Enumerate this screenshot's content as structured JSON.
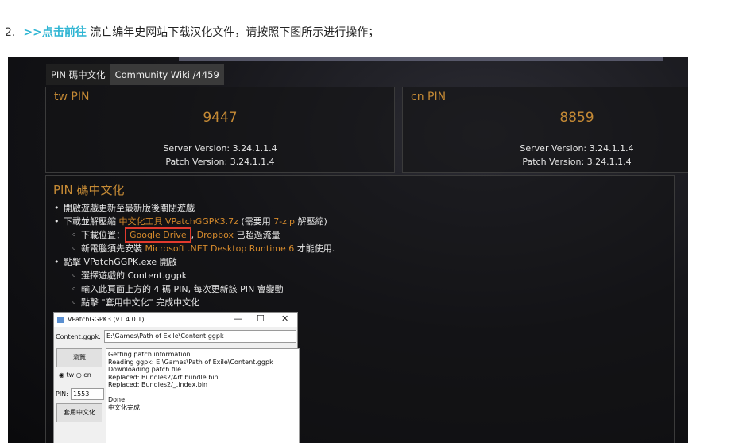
{
  "step": {
    "number": "2.",
    "link_label": ">>点击前往",
    "text": " 流亡编年史网站下载汉化文件，请按照下图所示进行操作；"
  },
  "app": {
    "tabs": [
      "PIN 碼中文化",
      "Community Wiki /4459"
    ],
    "tw": {
      "title": "tw PIN",
      "pin": "9447",
      "server_version": "Server Version: 3.24.1.1.4",
      "patch_version": "Patch Version: 3.24.1.1.4"
    },
    "cn": {
      "title": "cn PIN",
      "pin": "8859",
      "server_version": "Server Version: 3.24.1.1.4",
      "patch_version": "Patch Version: 3.24.1.1.4"
    },
    "section_title": "PIN 碼中文化",
    "items": {
      "i1": "開啟遊戲更新至最新版後關閉遊戲",
      "i2_a": "下載並解壓縮 ",
      "i2_b": "中文化工具 VPatchGGPK3.7z",
      "i2_c": " (需要用 ",
      "i2_d": "7-zip",
      "i2_e": " 解壓縮)",
      "i2_1a": "下載位置：",
      "i2_1b": "Google Drive",
      "i2_1c": ", ",
      "i2_1d": "Dropbox",
      "i2_1e": " 已超過流量",
      "i2_2a": "新電腦須先安裝 ",
      "i2_2b": "Microsoft .NET Desktop Runtime 6",
      "i2_2c": " 才能使用.",
      "i3": "點擊 VPatchGGPK.exe 開啟",
      "i3_1": "選擇遊戲的 Content.ggpk",
      "i3_2": "輸入此頁面上方的 4 碼 PIN, 每次更新該 PIN 會變動",
      "i3_3": "點擊 \"套用中文化\" 完成中文化"
    }
  },
  "window": {
    "title": "VPatchGGPK3 (v1.4.0.1)",
    "minimize": "—",
    "maximize": "☐",
    "close": "✕",
    "content_label": "Content.ggpk:",
    "content_path": "E:\\Games\\Path of Exile\\Content.ggpk",
    "browse_button": "瀏覽",
    "radio_tw": "tw",
    "radio_cn": "cn",
    "pin_label": "PIN:",
    "pin_value": "1553",
    "apply_button": "套用中文化",
    "log": "Getting patch information . . .\nReading ggpk: E:\\Games\\Path of Exile\\Content.ggpk\nDownloading patch file . . .\nReplaced: Bundles2/Art.bundle.bin\nReplaced: Bundles2/_.index.bin\n\nDone!\n中文化完成!"
  }
}
